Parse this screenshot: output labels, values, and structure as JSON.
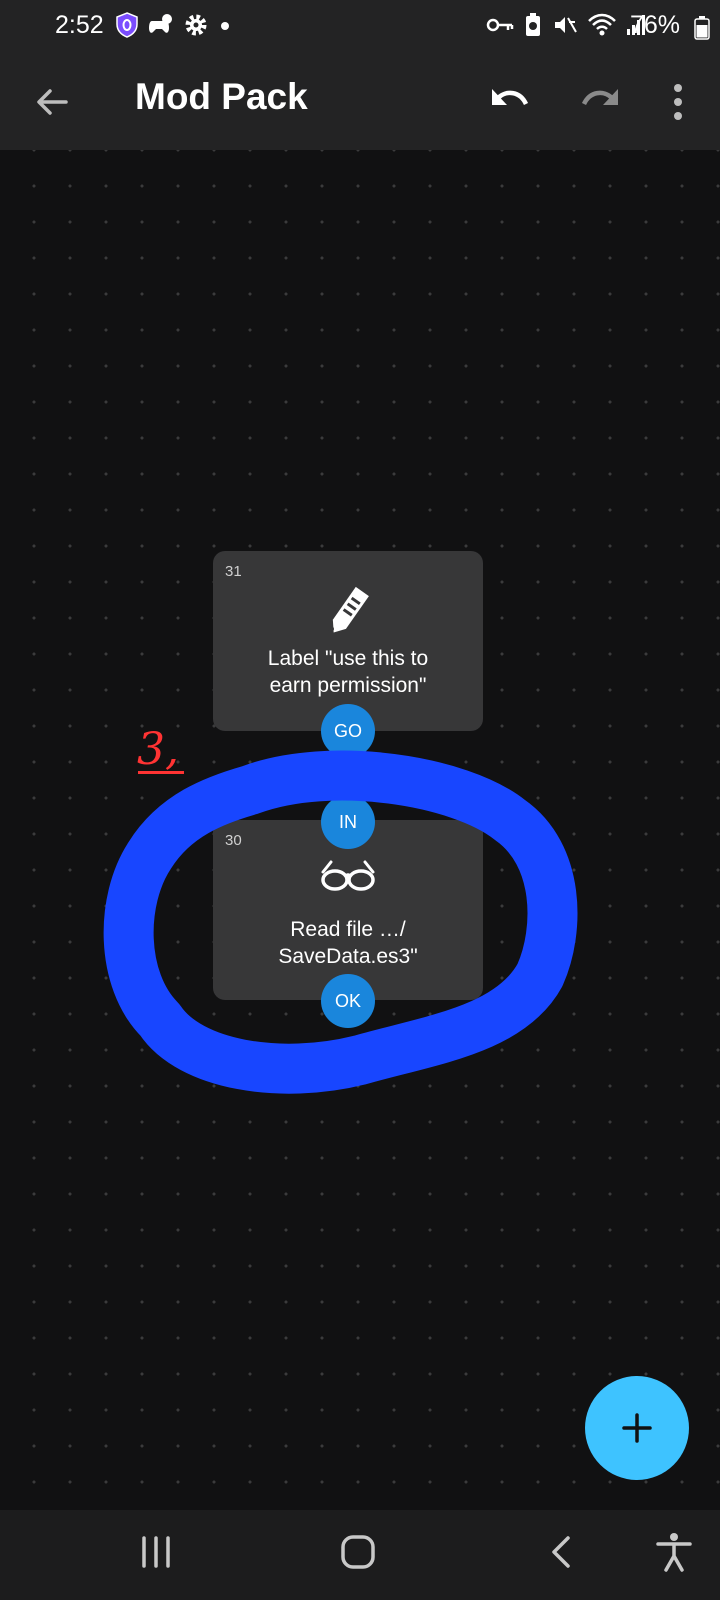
{
  "status_bar": {
    "time": "2:52",
    "battery_percent": "76%",
    "left_icons": [
      "shield-icon",
      "game-controller-icon",
      "gear-icon",
      "dot-icon"
    ],
    "right_icons": [
      "vpn-key-icon",
      "battery-saver-icon",
      "mute-icon",
      "wifi-icon",
      "signal-icon",
      "battery-icon"
    ]
  },
  "app_bar": {
    "title": "Mod Pack",
    "icons": [
      "back-arrow-icon",
      "undo-icon",
      "redo-icon",
      "more-vert-icon"
    ]
  },
  "canvas": {
    "nodes": [
      {
        "id": "31",
        "icon": "label-tag-icon",
        "text_line1": "Label \"use this to",
        "text_line2": "earn permission\"",
        "output_port": "GO"
      },
      {
        "id": "30",
        "icon": "glasses-icon",
        "input_port": "IN",
        "text_line1": "Read file …/",
        "text_line2": "SaveData.es3\"",
        "output_port": "OK"
      }
    ],
    "annotation": {
      "text": "3,",
      "circle_color": "#1846ff",
      "text_color": "#ff3333"
    }
  },
  "fab": {
    "icon": "plus-icon",
    "color": "#3ec3ff"
  },
  "nav_bar": {
    "icons": [
      "recent-apps-icon",
      "home-icon",
      "back-icon",
      "accessibility-icon"
    ]
  },
  "colors": {
    "background": "#111112",
    "app_bar": "#232324",
    "node": "#373738",
    "port": "#1a86dc"
  }
}
